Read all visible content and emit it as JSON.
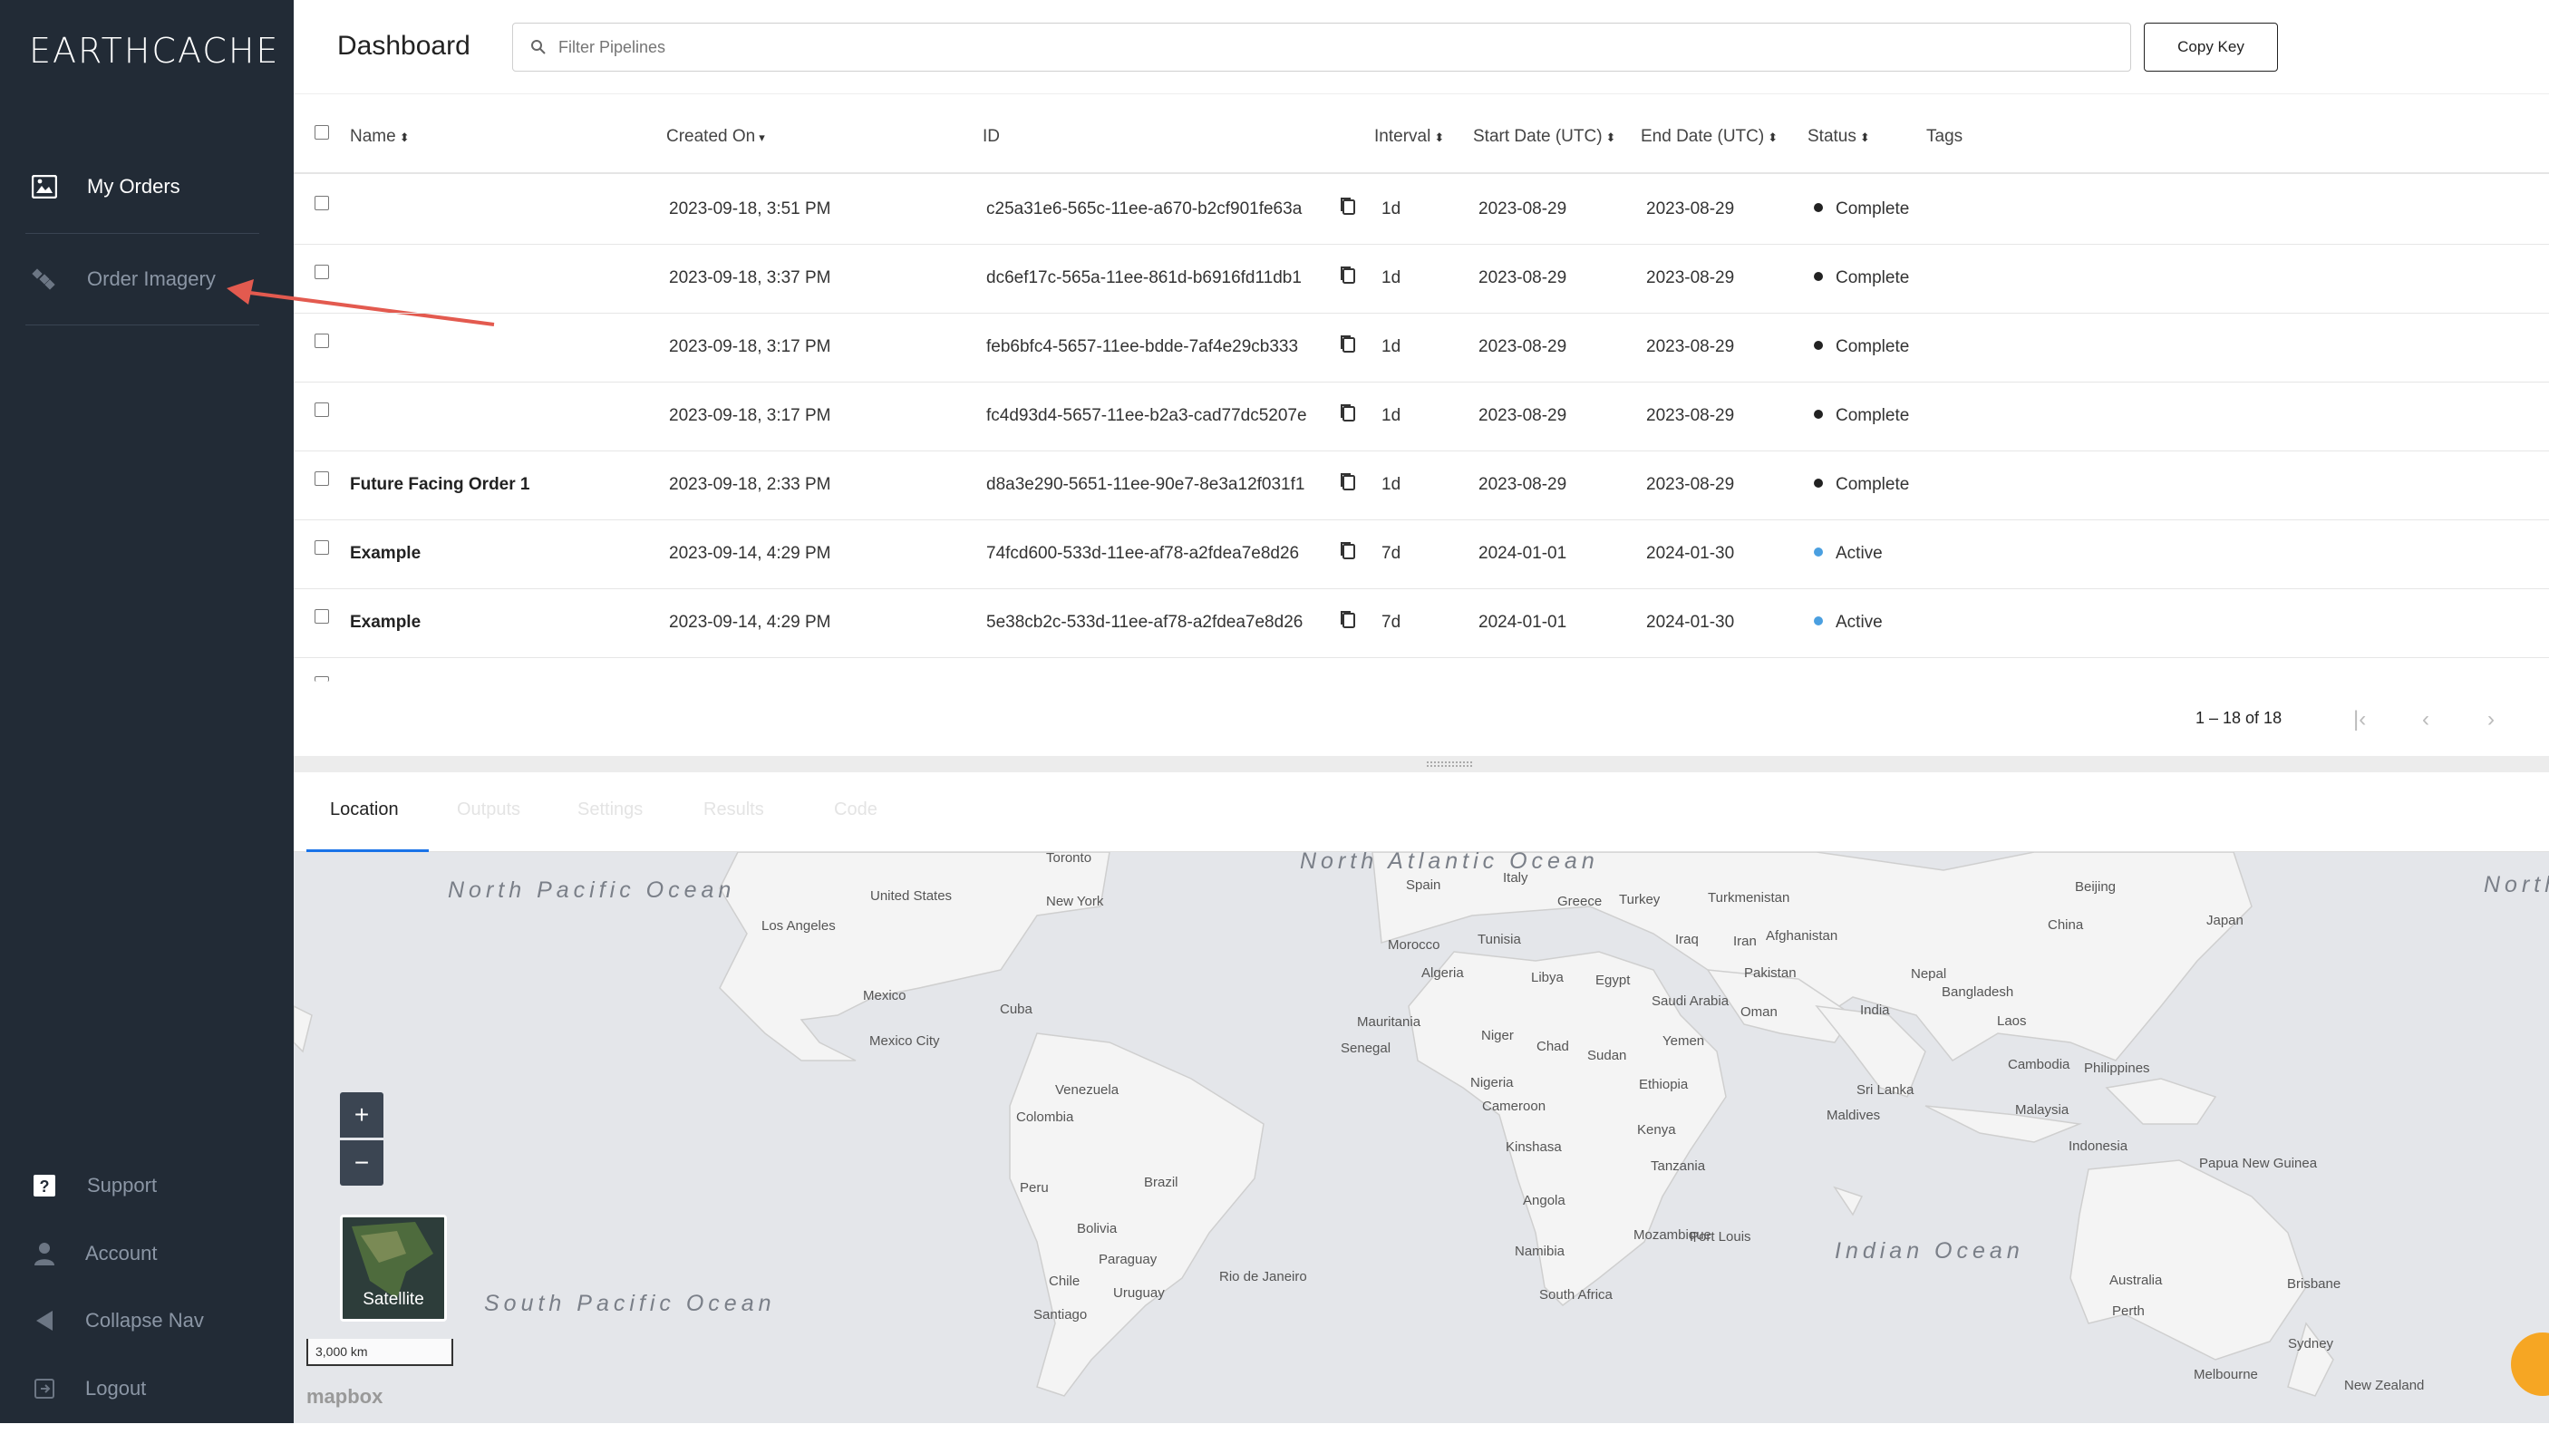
{
  "app": {
    "logo": "EARTHCACHE"
  },
  "sidebar": {
    "items": [
      {
        "label": "My Orders",
        "icon": "image-icon"
      },
      {
        "label": "Order Imagery",
        "icon": "satellite-icon"
      }
    ],
    "bottom": [
      {
        "label": "Support",
        "icon": "help-icon"
      },
      {
        "label": "Account",
        "icon": "person-icon"
      },
      {
        "label": "Collapse Nav",
        "icon": "triangle-left-icon"
      },
      {
        "label": "Logout",
        "icon": "logout-icon"
      }
    ]
  },
  "header": {
    "title": "Dashboard",
    "filter_placeholder": "Filter Pipelines",
    "copy_key_label": "Copy Key"
  },
  "table": {
    "columns": [
      "Name",
      "Created On",
      "ID",
      "Interval",
      "Start Date (UTC)",
      "End Date (UTC)",
      "Status",
      "Tags"
    ],
    "rows": [
      {
        "name": "",
        "created": "2023-09-18, 3:51 PM",
        "id": "c25a31e6-565c-11ee-a670-b2cf901fe63a",
        "interval": "1d",
        "start": "2023-08-29",
        "end": "2023-08-29",
        "status": "Complete"
      },
      {
        "name": "",
        "created": "2023-09-18, 3:37 PM",
        "id": "dc6ef17c-565a-11ee-861d-b6916fd11db1",
        "interval": "1d",
        "start": "2023-08-29",
        "end": "2023-08-29",
        "status": "Complete"
      },
      {
        "name": "",
        "created": "2023-09-18, 3:17 PM",
        "id": "feb6bfc4-5657-11ee-bdde-7af4e29cb333",
        "interval": "1d",
        "start": "2023-08-29",
        "end": "2023-08-29",
        "status": "Complete"
      },
      {
        "name": "",
        "created": "2023-09-18, 3:17 PM",
        "id": "fc4d93d4-5657-11ee-b2a3-cad77dc5207e",
        "interval": "1d",
        "start": "2023-08-29",
        "end": "2023-08-29",
        "status": "Complete"
      },
      {
        "name": "Future Facing Order 1",
        "created": "2023-09-18, 2:33 PM",
        "id": "d8a3e290-5651-11ee-90e7-8e3a12f031f1",
        "interval": "1d",
        "start": "2023-08-29",
        "end": "2023-08-29",
        "status": "Complete"
      },
      {
        "name": "Example",
        "created": "2023-09-14, 4:29 PM",
        "id": "74fcd600-533d-11ee-af78-a2fdea7e8d26",
        "interval": "7d",
        "start": "2024-01-01",
        "end": "2024-01-30",
        "status": "Active"
      },
      {
        "name": "Example",
        "created": "2023-09-14, 4:29 PM",
        "id": "5e38cb2c-533d-11ee-af78-a2fdea7e8d26",
        "interval": "7d",
        "start": "2024-01-01",
        "end": "2024-01-30",
        "status": "Active"
      }
    ],
    "status_colors": {
      "Complete": "#222222",
      "Active": "#4a9fe0"
    }
  },
  "pager": {
    "text": "1 – 18 of 18"
  },
  "tabs": [
    "Location",
    "Outputs",
    "Settings",
    "Results",
    "Code"
  ],
  "map": {
    "zoom_in": "+",
    "zoom_out": "−",
    "satellite_label": "Satellite",
    "scale": "3,000 km",
    "attribution": "mapbox",
    "oceans": {
      "north_pacific": "North Pacific Ocean",
      "north_atlantic": "North Atlantic Ocean",
      "south_pacific": "South Pacific Ocean",
      "indian": "Indian Ocean",
      "north_pacific_right": "North Pacific Ocean"
    },
    "labels": [
      "Toronto",
      "United States",
      "New York",
      "Los Angeles",
      "Mexico",
      "Cuba",
      "Mexico City",
      "Venezuela",
      "Colombia",
      "Peru",
      "Brazil",
      "Bolivia",
      "Paraguay",
      "Chile",
      "Uruguay",
      "Santiago",
      "Rio de Janeiro",
      "Spain",
      "Italy",
      "Greece",
      "Turkey",
      "Turkmenistan",
      "Beijing",
      "China",
      "Japan",
      "Morocco",
      "Tunisia",
      "Iraq",
      "Iran",
      "Afghanistan",
      "Algeria",
      "Libya",
      "Egypt",
      "Pakistan",
      "Nepal",
      "Bangladesh",
      "Saudi Arabia",
      "Oman",
      "India",
      "Laos",
      "Mauritania",
      "Niger",
      "Chad",
      "Sudan",
      "Senegal",
      "Yemen",
      "Nigeria",
      "Ethiopia",
      "Cambodia",
      "Philippines",
      "Cameroon",
      "Sri Lanka",
      "Maldives",
      "Malaysia",
      "Kenya",
      "Kinshasa",
      "Tanzania",
      "Indonesia",
      "Papua New Guinea",
      "Angola",
      "Mozambique",
      "Port Louis",
      "Namibia",
      "South Africa",
      "Australia",
      "Brisbane",
      "Perth",
      "Sydney",
      "Melbourne",
      "New Zealand"
    ]
  }
}
